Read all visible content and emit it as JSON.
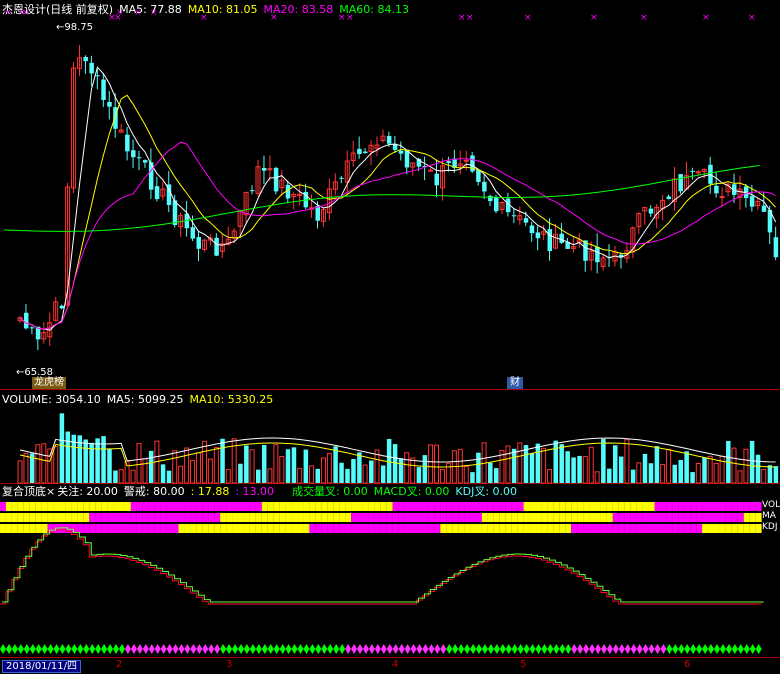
{
  "price_panel": {
    "title": "杰恩设计(日线 前复权)",
    "ma5_label": "MA5: 77.88",
    "ma10_label": "MA10: 81.05",
    "ma20_label": "MA20: 83.58",
    "ma60_label": "MA60: 84.13",
    "high_marker": "98.75",
    "low_marker": "65.58",
    "news_tags": [
      "龙虎榜",
      "财"
    ],
    "colors": {
      "ma5": "#ffffff",
      "ma10": "#ffff00",
      "ma20": "#ff00ff",
      "ma60": "#00ff00",
      "up": "#ff3333",
      "down": "#54fcfc"
    }
  },
  "volume_panel": {
    "volume_label": "VOLUME: 3054.10",
    "ma5_label": "MA5: 5099.25",
    "ma10_label": "MA10: 5330.25"
  },
  "indicator_panel": {
    "title": "复合顶底×",
    "focus_label": "关注: 20.00",
    "alert_label": "警戒: 80.00",
    "value1": ": 17.88",
    "value2": ": 13.00",
    "vol_cross_label": "成交量叉: 0.00",
    "macd_cross_label": "MACD叉: 0.00",
    "kdj_cross_label": "KDJ叉: 0.00",
    "side_labels": [
      "VOL",
      "MA",
      "KDJ"
    ]
  },
  "date_axis": {
    "date_box": "2018/01/11/四",
    "month_ticks": [
      "2",
      "3",
      "4",
      "5",
      "6"
    ]
  }
}
